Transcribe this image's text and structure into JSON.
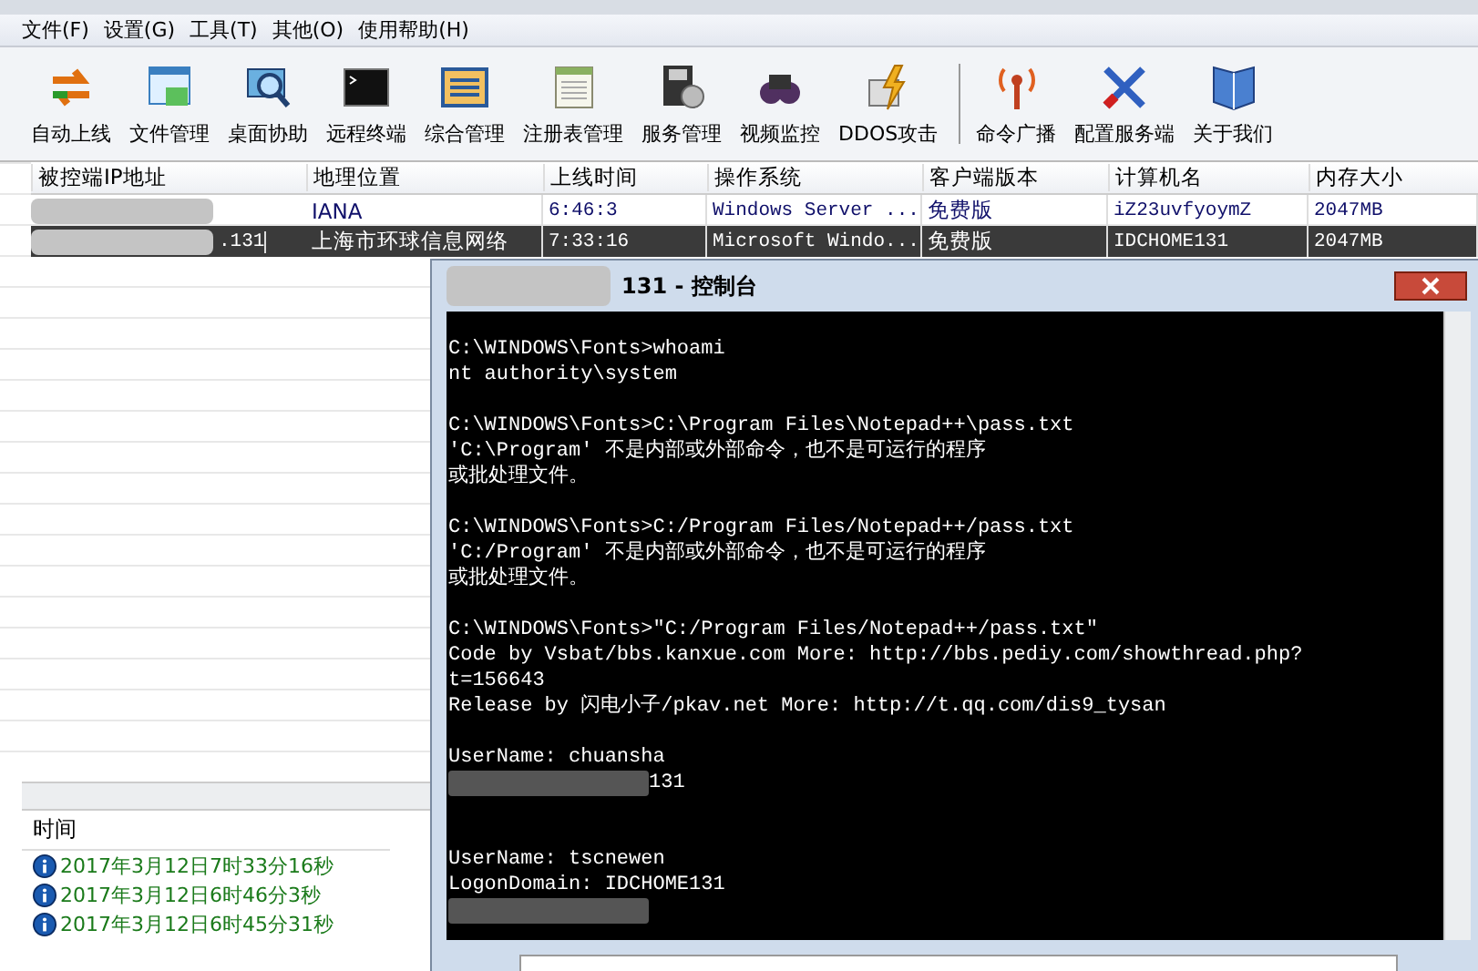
{
  "menu": [
    "文件(F)",
    "设置(G)",
    "工具(T)",
    "其他(O)",
    "使用帮助(H)"
  ],
  "toolbar": [
    "自动上线",
    "文件管理",
    "桌面协助",
    "远程终端",
    "综合管理",
    "注册表管理",
    "服务管理",
    "视频监控",
    "DDOS攻击",
    "命令广播",
    "配置服务端",
    "关于我们"
  ],
  "table": {
    "columns": [
      "被控端IP地址",
      "地理位置",
      "上线时间",
      "操作系统",
      "客户端版本",
      "计算机名",
      "内存大小"
    ],
    "rows": [
      {
        "selected": false,
        "cells": [
          "",
          "IANA",
          "6:46:3",
          "Windows Server ...",
          "免费版",
          "iZ23uvfyoymZ",
          "2047MB"
        ]
      },
      {
        "selected": true,
        "cells": [
          ".131",
          "上海市环球信息网络",
          "7:33:16",
          "Microsoft Windo...",
          "免费版",
          "IDCHOME131",
          "2047MB"
        ]
      }
    ]
  },
  "log": {
    "column": "时间",
    "entries": [
      "2017年3月12日7时33分16秒",
      "2017年3月12日6时46分3秒",
      "2017年3月12日6时45分31秒"
    ]
  },
  "console": {
    "title": "131 - 控制台",
    "lines": [
      {
        "kind": "blank"
      },
      {
        "kind": "text",
        "text": "C:\\WINDOWS\\Fonts>whoami"
      },
      {
        "kind": "text",
        "text": "nt authority\\system"
      },
      {
        "kind": "blank"
      },
      {
        "kind": "text",
        "text": "C:\\WINDOWS\\Fonts>C:\\Program Files\\Notepad++\\pass.txt"
      },
      {
        "kind": "text",
        "text": "'C:\\Program' 不是内部或外部命令，也不是可运行的程序"
      },
      {
        "kind": "text",
        "text": "或批处理文件。"
      },
      {
        "kind": "blank"
      },
      {
        "kind": "text",
        "text": "C:\\WINDOWS\\Fonts>C:/Program Files/Notepad++/pass.txt"
      },
      {
        "kind": "text",
        "text": "'C:/Program' 不是内部或外部命令，也不是可运行的程序"
      },
      {
        "kind": "text",
        "text": "或批处理文件。"
      },
      {
        "kind": "blank"
      },
      {
        "kind": "text",
        "text": "C:\\WINDOWS\\Fonts>\"C:/Program Files/Notepad++/pass.txt\""
      },
      {
        "kind": "text",
        "text": "Code by Vsbat/bbs.kanxue.com More: http://bbs.pediy.com/showthread.php?"
      },
      {
        "kind": "text",
        "text": "t=156643"
      },
      {
        "kind": "text",
        "text": "Release by 闪电小子/pkav.net More: http://t.qq.com/dis9_tysan"
      },
      {
        "kind": "blank"
      },
      {
        "kind": "text",
        "text": "UserName: chuansha"
      },
      {
        "kind": "redacted",
        "text": "131"
      },
      {
        "kind": "blank"
      },
      {
        "kind": "blank"
      },
      {
        "kind": "text",
        "text": "UserName: tscnewen"
      },
      {
        "kind": "text",
        "text": "LogonDomain: IDCHOME131"
      },
      {
        "kind": "redacted"
      }
    ]
  }
}
